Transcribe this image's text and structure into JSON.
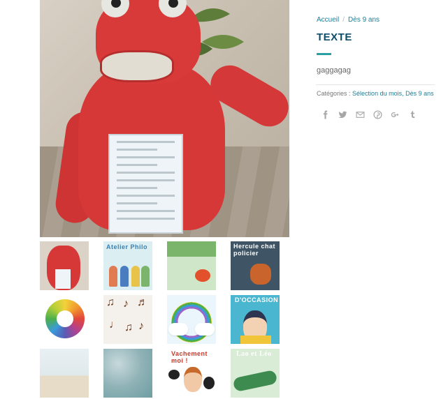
{
  "product": {
    "breadcrumb": [
      "Accueil",
      "Dès 9 ans"
    ],
    "breadcrumb_separator": "/",
    "title": "TEXTE",
    "description": "gaggagag",
    "categories_label": "Catégories :",
    "categories": "Sélection du mois, Dès 9 ans"
  },
  "share_icons": [
    "facebook-icon",
    "twitter-icon",
    "envelope-icon",
    "pinterest-icon",
    "google-plus-icon",
    "tumblr-icon"
  ],
  "thumbnails": [
    {
      "name": "thumb-red-monkey"
    },
    {
      "name": "thumb-atelier-philo",
      "text": "Atelier Philo"
    },
    {
      "name": "thumb-fish-book"
    },
    {
      "name": "thumb-hercule",
      "text": "Hercule chat policier"
    },
    {
      "name": "thumb-color-wheel"
    },
    {
      "name": "thumb-instruments"
    },
    {
      "name": "thumb-rainbow"
    },
    {
      "name": "thumb-occasion",
      "text": "D'OCCASION"
    },
    {
      "name": "thumb-beach"
    },
    {
      "name": "thumb-sea"
    },
    {
      "name": "thumb-vachement",
      "text": "Vachement moi !"
    },
    {
      "name": "thumb-lao-leo",
      "text": "Lao et Léo"
    }
  ],
  "colors": {
    "accent": "#1a7f97",
    "title": "#0b4d6b",
    "rule": "#2aa0a6"
  }
}
